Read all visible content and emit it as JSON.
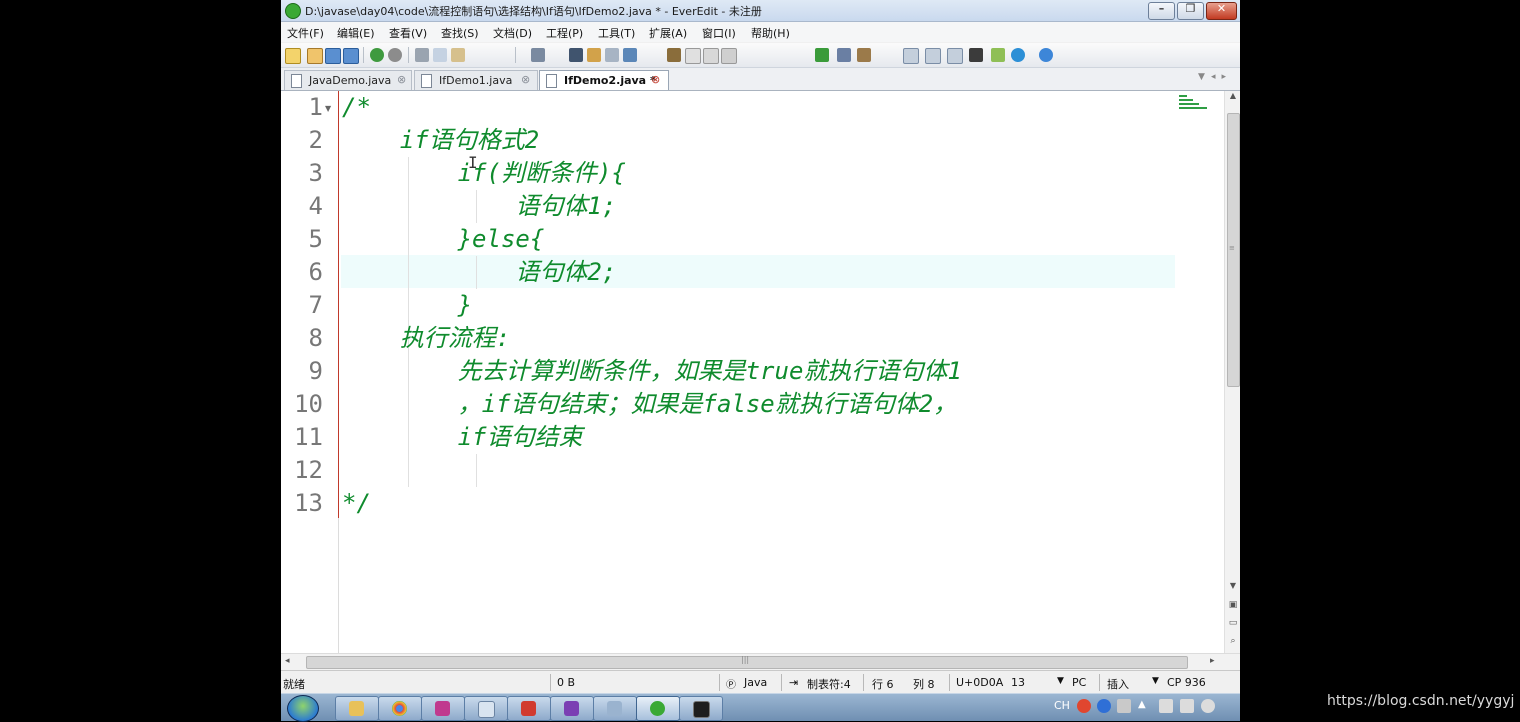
{
  "window": {
    "title": "D:\\javase\\day04\\code\\流程控制语句\\选择结构\\If语句\\IfDemo2.java * - EverEdit - 未注册"
  },
  "menu": [
    "文件(F)",
    "编辑(E)",
    "查看(V)",
    "查找(S)",
    "文档(D)",
    "工程(P)",
    "工具(T)",
    "扩展(A)",
    "窗口(I)",
    "帮助(H)"
  ],
  "tabs": [
    {
      "label": "JavaDemo.java",
      "close": "⊗"
    },
    {
      "label": "IfDemo1.java",
      "close": "⊗"
    },
    {
      "label": "IfDemo2.java *",
      "close": "⊗"
    }
  ],
  "editor": {
    "line_numbers": [
      "1",
      "2",
      "3",
      "4",
      "5",
      "6",
      "7",
      "8",
      "9",
      "10",
      "11",
      "12",
      "13"
    ],
    "lines": [
      "/*",
      "    if语句格式2",
      "        if(判断条件){",
      "            语句体1;",
      "        }else{",
      "            语句体2;",
      "        }",
      "    执行流程:",
      "        先去计算判断条件，如果是true就执行语句体1",
      "        ，if语句结束；如果是false就执行语句体2，",
      "        if语句结束",
      "",
      "*/"
    ],
    "current_line": 6,
    "text_color": "#0f8b2d"
  },
  "status": {
    "ready": "就绪",
    "size": "0 B",
    "language": "Java",
    "tab_setting": "制表符:4",
    "row": "行 6",
    "col": "列 8",
    "char_code": "U+0D0A",
    "value": "13",
    "line_ending": "PC",
    "mode": "插入",
    "encoding": "CP 936"
  },
  "tray": {
    "ime": "CH"
  },
  "watermark": "https://blog.csdn.net/yygyj"
}
